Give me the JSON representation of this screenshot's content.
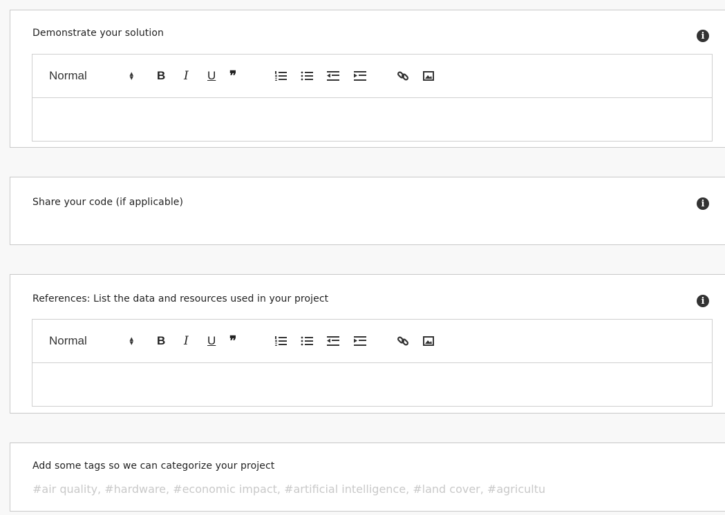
{
  "sections": {
    "demonstrate": {
      "title": "Demonstrate your solution"
    },
    "code": {
      "title": "Share your code (if applicable)"
    },
    "references": {
      "title": "References: List the data and resources used in your project"
    },
    "tags": {
      "title": "Add some tags so we can categorize your project",
      "placeholder": "#air quality, #hardware, #economic impact, #artificial intelligence, #land cover, #agricultu",
      "value": ""
    }
  },
  "editor": {
    "format_label": "Normal",
    "bold": "B",
    "italic": "I",
    "underline": "U",
    "quote": "❞"
  },
  "icons": {
    "info": "info-icon",
    "ordered_list": "ordered-list-icon",
    "bullet_list": "bullet-list-icon",
    "outdent": "outdent-icon",
    "indent": "indent-icon",
    "link": "link-icon",
    "image": "image-icon"
  },
  "colors": {
    "border": "#c8c8c8",
    "placeholder": "#c9c9c9",
    "icon": "#333333"
  }
}
